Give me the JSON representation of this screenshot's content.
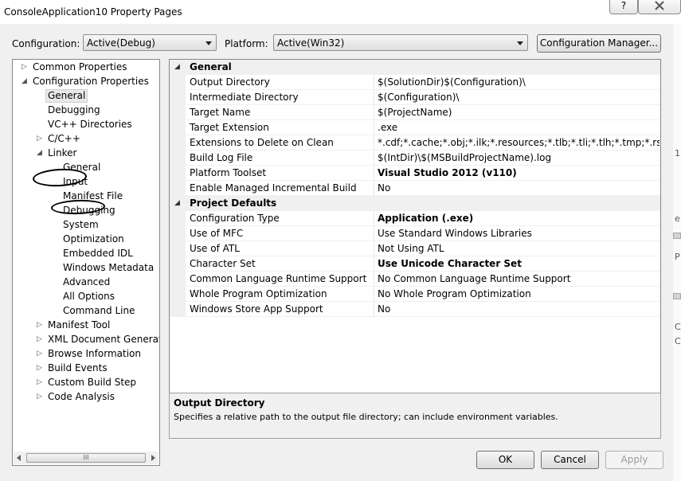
{
  "window": {
    "title": "ConsoleApplication10 Property Pages",
    "help_label": "?"
  },
  "toolbar": {
    "configuration_label": "Configuration:",
    "configuration_value": "Active(Debug)",
    "platform_label": "Platform:",
    "platform_value": "Active(Win32)",
    "config_manager_label": "Configuration Manager..."
  },
  "tree": {
    "items": [
      {
        "label": "Common Properties",
        "expander": "▷"
      },
      {
        "label": "Configuration Properties",
        "expander": "◢"
      },
      {
        "label": "General"
      },
      {
        "label": "Debugging"
      },
      {
        "label": "VC++ Directories"
      },
      {
        "label": "C/C++",
        "expander": "▷"
      },
      {
        "label": "Linker",
        "expander": "◢"
      },
      {
        "label": "General"
      },
      {
        "label": "Input"
      },
      {
        "label": "Manifest File"
      },
      {
        "label": "Debugging"
      },
      {
        "label": "System"
      },
      {
        "label": "Optimization"
      },
      {
        "label": "Embedded IDL"
      },
      {
        "label": "Windows Metadata"
      },
      {
        "label": "Advanced"
      },
      {
        "label": "All Options"
      },
      {
        "label": "Command Line"
      },
      {
        "label": "Manifest Tool",
        "expander": "▷"
      },
      {
        "label": "XML Document Generator",
        "expander": "▷"
      },
      {
        "label": "Browse Information",
        "expander": "▷"
      },
      {
        "label": "Build Events",
        "expander": "▷"
      },
      {
        "label": "Custom Build Step",
        "expander": "▷"
      },
      {
        "label": "Code Analysis",
        "expander": "▷"
      }
    ],
    "scroll_grip": "III"
  },
  "grid": {
    "categories": [
      {
        "name": "General",
        "arrow": "◢",
        "rows": [
          {
            "name": "Output Directory",
            "value": "$(SolutionDir)$(Configuration)\\"
          },
          {
            "name": "Intermediate Directory",
            "value": "$(Configuration)\\"
          },
          {
            "name": "Target Name",
            "value": "$(ProjectName)"
          },
          {
            "name": "Target Extension",
            "value": ".exe"
          },
          {
            "name": "Extensions to Delete on Clean",
            "value": "*.cdf;*.cache;*.obj;*.ilk;*.resources;*.tlb;*.tli;*.tlh;*.tmp;*.rsp;*.pgc;*.p"
          },
          {
            "name": "Build Log File",
            "value": "$(IntDir)\\$(MSBuildProjectName).log"
          },
          {
            "name": "Platform Toolset",
            "value": "Visual Studio 2012 (v110)"
          },
          {
            "name": "Enable Managed Incremental Build",
            "value": "No"
          }
        ]
      },
      {
        "name": "Project Defaults",
        "arrow": "◢",
        "rows": [
          {
            "name": "Configuration Type",
            "value": "Application (.exe)"
          },
          {
            "name": "Use of MFC",
            "value": "Use Standard Windows Libraries"
          },
          {
            "name": "Use of ATL",
            "value": "Not Using ATL"
          },
          {
            "name": "Character Set",
            "value": "Use Unicode Character Set"
          },
          {
            "name": "Common Language Runtime Support",
            "value": "No Common Language Runtime Support"
          },
          {
            "name": "Whole Program Optimization",
            "value": "No Whole Program Optimization"
          },
          {
            "name": "Windows Store App Support",
            "value": "No"
          }
        ]
      }
    ]
  },
  "description": {
    "title": "Output Directory",
    "text": "Specifies a relative path to the output file directory; can include environment variables."
  },
  "buttons": {
    "ok": "OK",
    "cancel": "Cancel",
    "apply": "Apply"
  },
  "background_fragments": [
    "1",
    "e",
    "P",
    "C",
    "C"
  ]
}
